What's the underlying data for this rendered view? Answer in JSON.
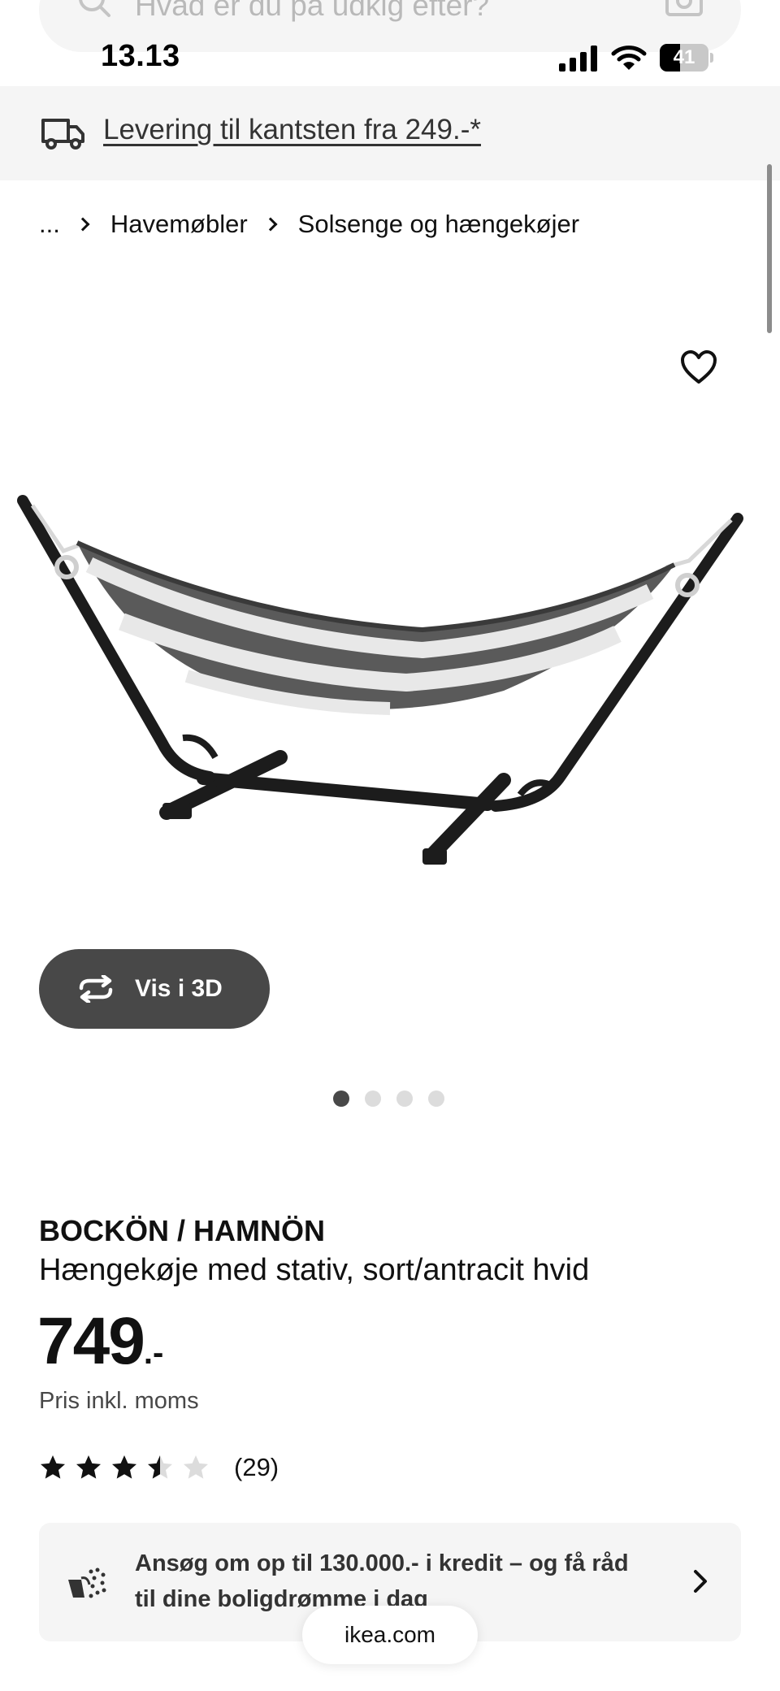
{
  "search": {
    "placeholder": "Hvad er du på udkig efter?"
  },
  "status_bar": {
    "time": "13.13",
    "battery": "41",
    "battery_level": 0.41
  },
  "delivery_banner": {
    "text": "Levering til kantsten fra 249.-*"
  },
  "breadcrumb": {
    "ellipsis": "...",
    "items": [
      "Havemøbler",
      "Solsenge og hængekøjer"
    ]
  },
  "gallery": {
    "view3d_label": "Vis i 3D",
    "dot_count": 4,
    "active_dot": 1
  },
  "product": {
    "name": "BOCKÖN / HAMNÖN",
    "description": "Hængekøje med stativ, sort/antracit hvid",
    "price_integer": "749",
    "price_suffix": ".-",
    "price_note": "Pris inkl. moms",
    "rating_value": 3.5,
    "rating_max": 5,
    "rating_count": "(29)"
  },
  "credit_offer": {
    "text": "Ansøg om op til 130.000.- i kredit – og få råd til dine boligdrømme i dag"
  },
  "browser": {
    "url": "ikea.com"
  },
  "colors": {
    "banner_bg": "#f5f5f5",
    "dark_button": "#484848",
    "text": "#111111"
  },
  "icons": [
    "search-icon",
    "camera-icon",
    "truck-icon",
    "heart-icon",
    "rotate-3d-icon",
    "star-icon",
    "credit-icon",
    "chevron-right-icon"
  ]
}
